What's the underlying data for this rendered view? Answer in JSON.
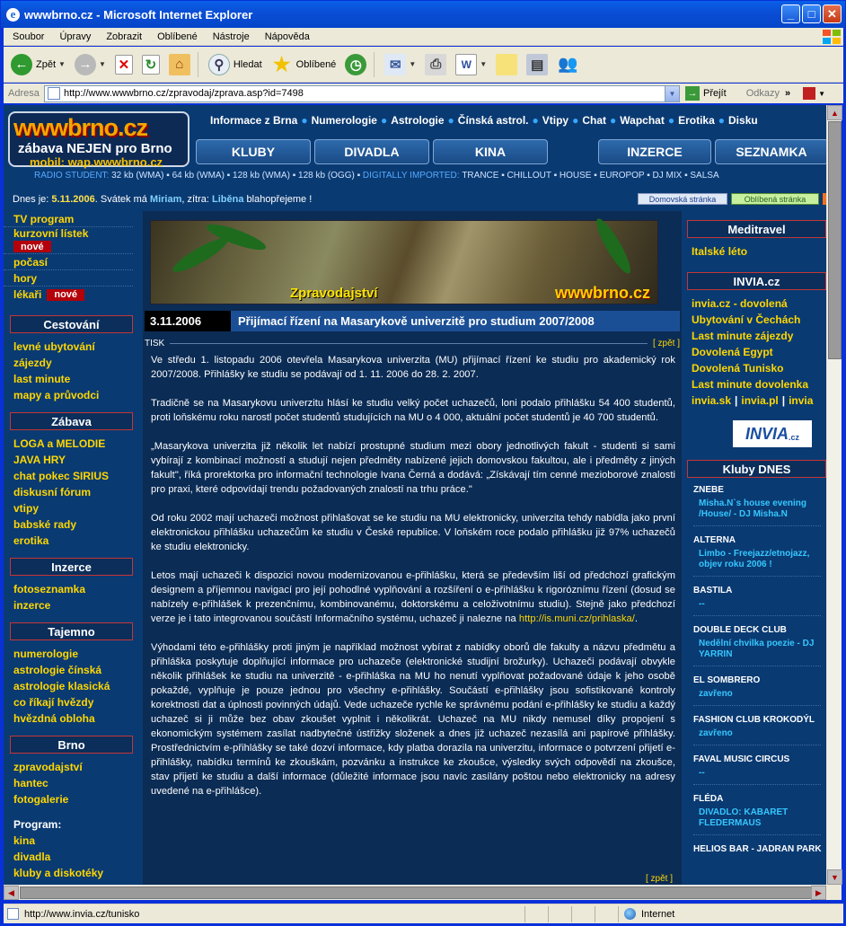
{
  "window": {
    "title": "wwwbrno.cz - Microsoft Internet Explorer",
    "menu": [
      "Soubor",
      "Úpravy",
      "Zobrazit",
      "Oblíbené",
      "Nástroje",
      "Nápověda"
    ],
    "toolbar": {
      "back": "Zpět",
      "search": "Hledat",
      "favorites": "Oblíbené"
    },
    "address_label": "Adresa",
    "address_value": "http://www.wwwbrno.cz/zpravodaj/zprava.asp?id=7498",
    "go_label": "Přejít",
    "links_label": "Odkazy",
    "status_url": "http://www.invia.cz/tunisko",
    "status_zone": "Internet"
  },
  "site": {
    "logo": {
      "line1": "wwwbrno.cz",
      "line2": "zábava NEJEN pro Brno",
      "line3": "mobil: wap.wwwbrno.cz"
    },
    "topnav": [
      "Informace z Brna",
      "Numerologie",
      "Astrologie",
      "Čínská astrol.",
      "Vtipy",
      "Chat",
      "Wapchat",
      "Erotika",
      "Disku"
    ],
    "tabs": [
      "KLUBY",
      "DIVADLA",
      "KINA",
      "INZERCE",
      "SEZNAMKA"
    ],
    "radio": {
      "label": "RADIO STUDENT:",
      "items": "32 kb (WMA) ▪ 64 kb (WMA) ▪ 128 kb (WMA) ▪ 128 kb (OGG) ▪",
      "label2": "DIGITALLY IMPORTED:",
      "items2": "TRANCE ▪ CHILLOUT ▪ HOUSE ▪ EUROPOP ▪ DJ MIX ▪ SALSA"
    },
    "date": {
      "prefix": "Dnes je:",
      "date": "5.11.2006",
      "svatek": ". Svátek má",
      "name1": "Miriam",
      "zitra": ", zítra:",
      "name2": "Liběna",
      "suffix": "blahopřejeme !",
      "btn_home": "Domovská stránka",
      "btn_fav": "Oblíbená stránka"
    }
  },
  "left": {
    "top_links": [
      "TV program",
      "kurzovní lístek",
      "počasí",
      "hory",
      "lékaři"
    ],
    "nove": "nové",
    "cestovani": {
      "head": "Cestování",
      "items": [
        "levné ubytování",
        "zájezdy",
        "last minute",
        "mapy a průvodci"
      ]
    },
    "zabava": {
      "head": "Zábava",
      "items": [
        "LOGA a MELODIE",
        "JAVA HRY",
        "chat pokec SIRIUS",
        "diskusní fórum",
        "vtipy",
        "babské rady",
        "erotika"
      ]
    },
    "inzerce": {
      "head": "Inzerce",
      "items": [
        "fotoseznamka",
        "inzerce"
      ]
    },
    "tajemno": {
      "head": "Tajemno",
      "items": [
        "numerologie",
        "astrologie čínská",
        "astrologie klasická",
        "co říkají hvězdy",
        "hvězdná obloha"
      ]
    },
    "brno": {
      "head": "Brno",
      "items": [
        "zpravodajství",
        "hantec",
        "fotogalerie"
      ]
    },
    "program": {
      "head": "Program:",
      "items": [
        "kina",
        "divadla",
        "kluby a diskotéky"
      ]
    }
  },
  "article": {
    "banner_title": "Zpravodajství",
    "banner_brand": "wwwbrno.cz",
    "date": "3.11.2006",
    "title": "Přijímací řízení na Masarykově univerzitě pro studium 2007/2008",
    "tisk": "TISK",
    "zpet": "[ zpět ]",
    "p1": "Ve středu 1. listopadu 2006 otevřela Masarykova univerzita (MU) přijímací řízení ke studiu pro akademický rok 2007/2008. Přihlášky ke studiu se podávají od 1. 11. 2006 do 28. 2. 2007.",
    "p2": "Tradičně se na Masarykovu univerzitu hlásí ke studiu velký počet uchazečů, loni podalo přihlášku 54 400 studentů, proti loňskému roku narostl počet studentů studujících na MU o 4 000, aktuální počet studentů je 40 700 studentů.",
    "p3": "„Masarykova univerzita již několik let nabízí prostupné studium mezi obory jednotlivých fakult - studenti si sami vybírají z kombinací možností a studují nejen předměty nabízené jejich domovskou fakultou, ale i předměty z jiných fakult\", říká prorektorka pro informační technologie Ivana Černá a dodává: „Získávají tím cenné mezioborové znalosti pro praxi, které odpovídají trendu požadovaných znalostí na trhu práce.\"",
    "p4": "Od roku 2002 mají uchazeči možnost přihlašovat se ke studiu na MU elektronicky, univerzita tehdy nabídla jako první elektronickou přihlášku uchazečům ke studiu v České republice. V loňském roce podalo přihlášku již 97% uchazečů ke studiu elektronicky.",
    "p5": "Letos mají uchazeči k dispozici novou modernizovanou e-přihlášku, která se především liší od předchozí grafickým designem a příjemnou navigací pro její pohodlné vyplňování a rozšíření o e-přihlášku k rigoróznímu řízení (dosud se nabízely e-přihlášek k prezenčnímu, kombinovanému, doktorskému a celoživotnímu studiu). Stejně jako předchozí verze je i tato integrovanou součástí Informačního systému, uchazeč ji nalezne na",
    "p5_link": "http://is.muni.cz/prihlaska/",
    "p5_end": ".",
    "p6": "Výhodami této e-přihlášky proti jiným je například možnost vybírat z nabídky oborů dle fakulty a názvu předmětu a přihláška poskytuje doplňující informace pro uchazeče (elektronické studijní brožurky). Uchazeči podávají obvykle několik přihlášek ke studiu na univerzitě - e-přihláška na MU ho nenutí vyplňovat požadované údaje k jeho osobě pokaždé, vyplňuje je pouze jednou pro všechny e-přihlášky. Součástí e-přihlášky jsou sofistikované kontroly korektnosti dat a úplnosti povinných údajů. Vede uchazeče rychle ke správnému podání e-přihlášky ke studiu a každý uchazeč si ji může bez obav zkoušet vyplnit i několikrát. Uchazeč na MU nikdy nemusel díky propojení s ekonomickým systémem zasílat nadbytečné ústřižky složenek a dnes již uchazeč nezasílá ani papírové přihlášky. Prostřednictvím e-přihlášky se také dozví informace, kdy platba dorazila na univerzitu, informace o potvrzení přijetí e-přihlášky, nabídku termínů ke zkouškám, pozvánku a instrukce ke zkoušce, výsledky svých odpovědí na zkoušce, stav přijetí ke studiu a další informace (důležité informace jsou navíc zasílány poštou nebo elektronicky na adresy uvedené na e-přihlášce)."
  },
  "right": {
    "meditravel": {
      "head": "Meditravel",
      "items": [
        "Italské léto"
      ]
    },
    "invia": {
      "head": "INVIA.cz",
      "items": [
        "invia.cz - dovolená",
        "Ubytování v Čechách",
        "Last minute zájezdy",
        "Dovolená Egypt",
        "Dovolená Tunisko",
        "Last minute dovolenka"
      ],
      "multi": [
        "invia.sk",
        "invia.pl",
        "invia"
      ],
      "logo": "INVIA"
    },
    "kluby": {
      "head": "Kluby DNES",
      "items": [
        {
          "name": "ZNEBE",
          "event": "Misha.N`s house evening /House/ - DJ Misha.N"
        },
        {
          "name": "ALTERNA",
          "event": "Limbo - Freejazz/etnojazz, objev roku 2006 !"
        },
        {
          "name": "BASTILA",
          "event": "--"
        },
        {
          "name": "DOUBLE DECK CLUB",
          "event": "Nedělní chvilka poezie - DJ YARRIN"
        },
        {
          "name": "EL SOMBRERO",
          "event": "zavřeno"
        },
        {
          "name": "FASHION CLUB KROKODÝL",
          "event": "zavřeno"
        },
        {
          "name": "FAVAL MUSIC CIRCUS",
          "event": "--"
        },
        {
          "name": "FLÉDA",
          "event": "DIVADLO: KABARET FLEDERMAUS"
        },
        {
          "name": "HELIOS BAR - JADRAN PARK",
          "event": ""
        }
      ]
    }
  },
  "colors": {
    "page_bg": "#0a3a72",
    "link": "#ffd700",
    "accent_red": "#b4000a",
    "xp_blue": "#0a5fe8"
  }
}
